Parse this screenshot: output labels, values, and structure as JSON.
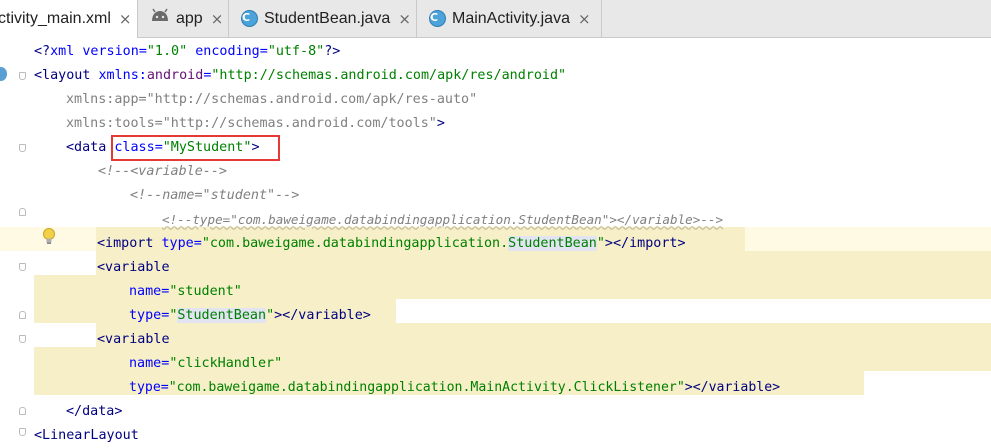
{
  "tabs": [
    {
      "label": "ctivity_main.xml",
      "active": true
    },
    {
      "label": "app",
      "icon": "android-icon"
    },
    {
      "label": "StudentBean.java",
      "icon": "java-class-icon"
    },
    {
      "label": "MainActivity.java",
      "icon": "java-class-icon"
    }
  ],
  "tab_close_glyph": "×",
  "class_icon_letter": "C",
  "code": {
    "l1": {
      "a": "<?",
      "b": "xml version",
      "c": "=",
      "d": "\"1.0\"",
      "e": " encoding",
      "f": "=",
      "g": "\"utf-8\"",
      "h": "?>"
    },
    "l2": {
      "a": "<layout ",
      "b": "xmlns:",
      "c": "android",
      "d": "=",
      "e": "\"http://schemas.android.com/apk/res/android\""
    },
    "l3": {
      "a": "xmlns:app=",
      "b": "\"http://schemas.android.com/apk/res-auto\""
    },
    "l4": {
      "a": "xmlns:tools=",
      "b": "\"http://schemas.android.com/tools\"",
      "c": ">"
    },
    "l5": {
      "a": "<data ",
      "b": "class",
      "c": "=",
      "d": "\"MyStudent\"",
      "e": ">"
    },
    "l6": {
      "a": "<!--<variable-->"
    },
    "l7": {
      "a": "<!--name=\"student\"-->"
    },
    "l8": {
      "a": "<!--type=\"com.baweigame.databindingapplication.StudentBean\"></variable>-->"
    },
    "l9": {
      "a": "<import ",
      "b": "type",
      "c": "=",
      "d": "\"com.baweigame.databindingapplication.",
      "e": "StudentBean",
      "f": "\"",
      "g": "></import>"
    },
    "l10": {
      "a": "<variable"
    },
    "l11": {
      "a": "name",
      "b": "=",
      "c": "\"student\""
    },
    "l12": {
      "a": "type",
      "b": "=",
      "c": "\"",
      "d": "StudentBean",
      "e": "\"",
      "f": "></variable>"
    },
    "l13": {
      "a": "<variable"
    },
    "l14": {
      "a": "name",
      "b": "=",
      "c": "\"clickHandler\""
    },
    "l15": {
      "a": "type",
      "b": "=",
      "c": "\"com.baweigame.databindingapplication.MainActivity.ClickListener\"",
      "d": "></variable>"
    },
    "l16": {
      "a": "</data>"
    },
    "l17": {
      "a": "<LinearLayout"
    }
  },
  "colors": {
    "tag": "#000080",
    "attribute": "#0000ff",
    "namespace": "#660e7a",
    "string": "#008000",
    "comment": "#808080",
    "highlight": "#f6efc7",
    "annotation_box": "#e53935"
  }
}
